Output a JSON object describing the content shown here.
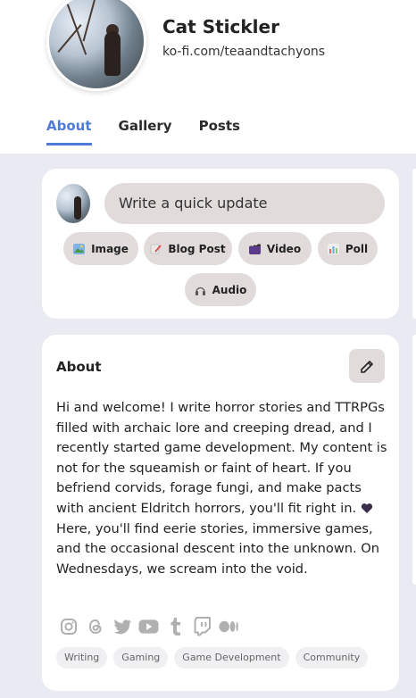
{
  "profile": {
    "name": "Cat Stickler",
    "url": "ko-fi.com/teaandtachyons"
  },
  "tabs": [
    {
      "label": "About",
      "active": true
    },
    {
      "label": "Gallery",
      "active": false
    },
    {
      "label": "Posts",
      "active": false
    }
  ],
  "composer": {
    "placeholder": "Write a quick update",
    "actions": [
      {
        "label": "Image",
        "icon": "image-icon"
      },
      {
        "label": "Blog Post",
        "icon": "blog-post-icon"
      },
      {
        "label": "Video",
        "icon": "video-icon"
      },
      {
        "label": "Poll",
        "icon": "poll-icon"
      },
      {
        "label": "Audio",
        "icon": "headphones-icon"
      }
    ]
  },
  "about": {
    "title": "About",
    "bio_part1": "Hi and welcome! I write horror stories and TTRPGs filled with archaic lore and creeping dread, and I recently started game development. My content is not for the squeamish or faint of heart. If you befriend corvids, forage fungi, and make pacts with ancient Eldritch horrors, you'll fit right in.",
    "bio_part2": "Here, you'll find eerie stories, immersive games, and the occasional descent into the unknown. On Wednesdays, we scream into the void.",
    "socials": [
      "instagram-icon",
      "threads-icon",
      "twitter-icon",
      "youtube-icon",
      "tumblr-icon",
      "twitch-icon",
      "medium-icon"
    ],
    "tags": [
      "Writing",
      "Gaming",
      "Game Development",
      "Community"
    ]
  },
  "colors": {
    "accent": "#4d7bd6",
    "pill_bg": "#e2dbdb",
    "page_bg": "#e9eaf2",
    "heart": "#3a2d4a"
  }
}
